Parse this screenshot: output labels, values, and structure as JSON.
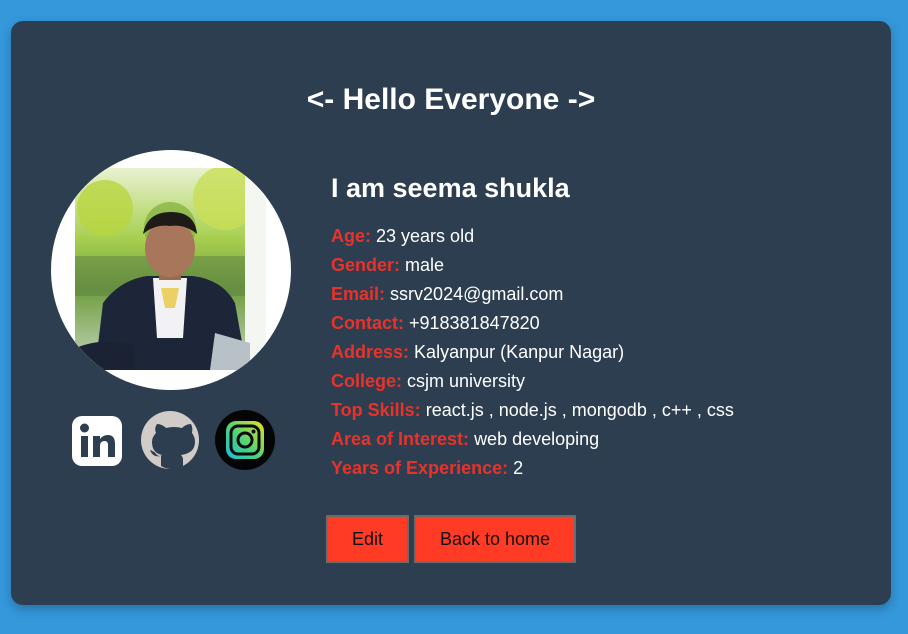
{
  "page": {
    "heading": "<- Hello Everyone ->"
  },
  "profile": {
    "name": "I am seema shukla",
    "photo_alt": "profile photo",
    "fields": [
      {
        "label": "Age:",
        "value": "23 years old"
      },
      {
        "label": "Gender:",
        "value": "male"
      },
      {
        "label": "Email:",
        "value": "ssrv2024@gmail.com"
      },
      {
        "label": "Contact:",
        "value": "+918381847820"
      },
      {
        "label": "Address:",
        "value": "Kalyanpur (Kanpur Nagar)"
      },
      {
        "label": "College:",
        "value": "csjm university"
      },
      {
        "label": "Top Skills:",
        "value": "react.js , node.js , mongodb , c++ , css"
      },
      {
        "label": "Area of Interest:",
        "value": "web developing"
      },
      {
        "label": "Years of Experience:",
        "value": "2"
      }
    ]
  },
  "socials": {
    "items": [
      {
        "name": "linkedin-icon"
      },
      {
        "name": "github-icon"
      },
      {
        "name": "instagram-icon"
      }
    ]
  },
  "actions": {
    "edit_label": "Edit",
    "home_label": "Back to home"
  },
  "colors": {
    "page_background": "#3498db",
    "card_background": "#2c3e50",
    "label_color": "#e8322a",
    "button_color": "#ff3b25"
  }
}
